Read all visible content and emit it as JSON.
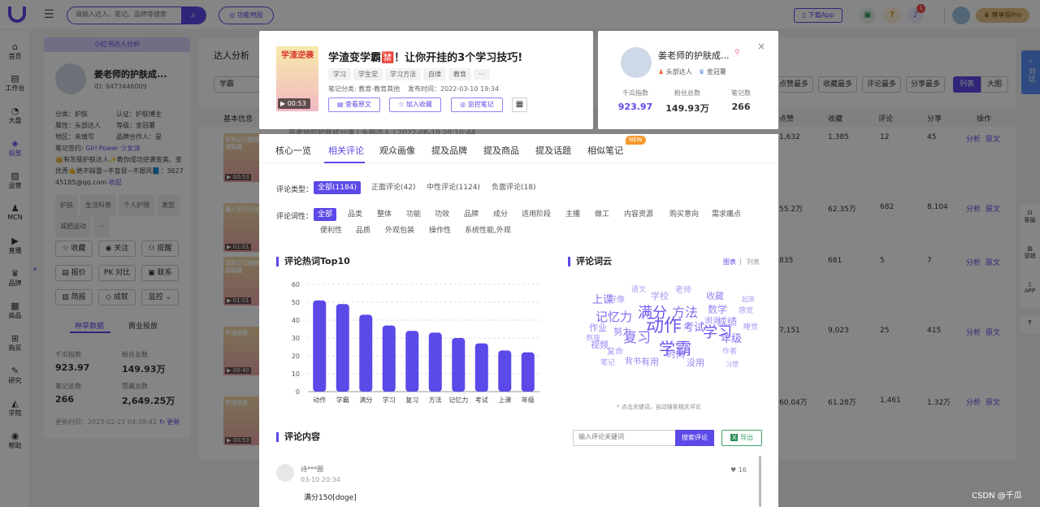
{
  "topbar": {
    "search_placeholder": "请输入达人、笔记、品牌等搜索",
    "feature_map": "功能地图",
    "download_app": "下载App",
    "notif_count": "1",
    "vip_label": "尊享版Pro"
  },
  "sidebar": [
    "首页",
    "工作台",
    "大盘",
    "投放",
    "运营",
    "MCN",
    "直播",
    "品牌",
    "商品",
    "购买",
    "研究",
    "学院",
    "帮助"
  ],
  "profile": {
    "header": "小红书达人分析",
    "name": "姜老师的护肤成...",
    "id": "ID: 9473446009",
    "rows": [
      "分类：护肤",
      "认证：护肤博主",
      "属性：头部达人",
      "等级：金冠薯",
      "地区：未填写",
      "品牌合作人：是"
    ],
    "sign_label": "笔记签约:",
    "sign_value": "Girl Power 少女派",
    "bio": "👑有灰级护肤达人✨教你成功逆袭变美、变优秀🤙绝不踩雷~不盲目~不跟风📘：362745185@qq.com",
    "bio_more": "收起",
    "tags": [
      "护肤",
      "生活科普",
      "个人护理",
      "发型",
      "减肥运动",
      "···"
    ],
    "actions": [
      "收藏",
      "关注",
      "提醒",
      "报价",
      "对比",
      "联系",
      "简报",
      "成就",
      "监控"
    ],
    "subtabs": [
      "种草数据",
      "商业投放"
    ],
    "stats": [
      {
        "label": "千瓜指数",
        "value": "923.97"
      },
      {
        "label": "粉丝总数",
        "value": "149.93万"
      },
      {
        "label": "笔记总数",
        "value": "266"
      },
      {
        "label": "赞藏总数",
        "value": "2,649.25万"
      }
    ],
    "updated": "更新时间：2023-02-22 04:38:42",
    "refresh": "更新"
  },
  "main": {
    "title": "达人分析",
    "filter_first": "学霸",
    "sort_buttons": [
      "点赞最多",
      "收藏最多",
      "评论最多",
      "分享最多"
    ],
    "view_buttons": [
      "列表",
      "大图"
    ],
    "columns": [
      "基本信息",
      "点赞",
      "收藏",
      "评论",
      "分享",
      "操作"
    ],
    "row_note": "姜老师的护肤成分课 | 头部达人 | 2022-06-10 20:10:44",
    "rows": [
      {
        "thumb_time": "00:53",
        "thumb_text": "该笔记已删除或隐藏",
        "likes": "1,632",
        "fav": "1,385",
        "comments": "12",
        "shares": "45"
      },
      {
        "thumb_time": "01:01",
        "thumb_text": "懒人学习方法",
        "likes": "55.2万",
        "fav": "62.35万",
        "comments": "682",
        "shares": "8,104"
      },
      {
        "thumb_time": "01:01",
        "thumb_text": "该笔记已删除或隐藏",
        "likes": "835",
        "fav": "681",
        "comments": "5",
        "shares": "7"
      },
      {
        "thumb_time": "00:40",
        "thumb_text": "学渣逆袭",
        "likes": "7,151",
        "fav": "9,023",
        "comments": "25",
        "shares": "415"
      },
      {
        "thumb_time": "00:53",
        "thumb_text": "学渣逆袭",
        "likes": "60.04万",
        "fav": "61.28万",
        "comments": "1,461",
        "shares": "1.32万"
      }
    ],
    "op_analysis": "分析",
    "op_source": "原文"
  },
  "right_tools": [
    "客服",
    "营销",
    "APP"
  ],
  "compare": "对比",
  "watermark": "CSDN @千瓜",
  "note": {
    "thumb_text": "学渣逆袭",
    "thumb_time": "00:53",
    "title": "学渣变学霸🈲！让你开挂的3个学习技巧!",
    "tags": [
      "学习",
      "学生党",
      "学习方法",
      "自律",
      "教育",
      "···"
    ],
    "category": "笔记分类: 教育-教育其他",
    "publish": "发布时间：2022-03-10 19:34",
    "buttons": [
      "查看原文",
      "加入收藏",
      "监控笔记"
    ]
  },
  "author": {
    "name": "姜老师的护肤成...",
    "badge1": "头部达人",
    "badge2": "金冠薯",
    "stats": [
      {
        "label": "千瓜指数",
        "value": "923.97"
      },
      {
        "label": "粉丝总数",
        "value": "149.93万"
      },
      {
        "label": "笔记数",
        "value": "266"
      }
    ]
  },
  "tabs": [
    "核心一览",
    "相关评论",
    "观众画像",
    "提及品牌",
    "提及商品",
    "提及话题",
    "相似笔记"
  ],
  "new_badge": "NEW",
  "filters": {
    "type_label": "评论类型：",
    "types": [
      "全部(1184)",
      "正面评论(42)",
      "中性评论(1124)",
      "负面评论(18)"
    ],
    "word_label": "评论词性：",
    "words_row1": [
      "全部",
      "品类",
      "整体",
      "功能",
      "功效",
      "品牌",
      "成分",
      "适用阶段",
      "主播",
      "做工",
      "内容资源",
      "购买意向",
      "需求痛点"
    ],
    "words_row2": [
      "便利性",
      "品质",
      "外观包装",
      "操作性",
      "系统性能,外观"
    ]
  },
  "chart_title": "评论热词Top10",
  "chart_data": {
    "type": "bar",
    "categories": [
      "动作",
      "学霸",
      "满分",
      "学习",
      "复习",
      "方法",
      "记忆力",
      "考试",
      "上课",
      "年级"
    ],
    "values": [
      51,
      49,
      43,
      37,
      34,
      33,
      30,
      27,
      23,
      22
    ],
    "ylim": [
      0,
      60
    ],
    "yticks": [
      0,
      10,
      20,
      30,
      40,
      50,
      60
    ],
    "grid": true,
    "color": "#5b49e8"
  },
  "cloud": {
    "title": "评论词云",
    "view_chart": "图表",
    "view_list": "列表",
    "hint": "* 点击关键词，自动搜索相关评论",
    "words": [
      "动作",
      "学霸",
      "满分",
      "学习",
      "复习",
      "方法",
      "记忆力",
      "考试",
      "上课",
      "年级",
      "数学",
      "成绩",
      "收藏",
      "作业",
      "视频",
      "有用",
      "时间",
      "没用",
      "背书",
      "努力",
      "熬夜",
      "好像",
      "语文",
      "学校",
      "老师",
      "谢谢",
      "感觉",
      "睡觉",
      "作者",
      "笔记",
      "起床",
      "习惯",
      "复命"
    ]
  },
  "comments": {
    "title": "评论内容",
    "search_placeholder": "输入评论关键词",
    "search_button": "搜索评论",
    "export_button": "导出",
    "item": {
      "user": "诗***圈",
      "date": "03-10 20:34",
      "text": "满分150[doge]",
      "likes": "16"
    }
  }
}
